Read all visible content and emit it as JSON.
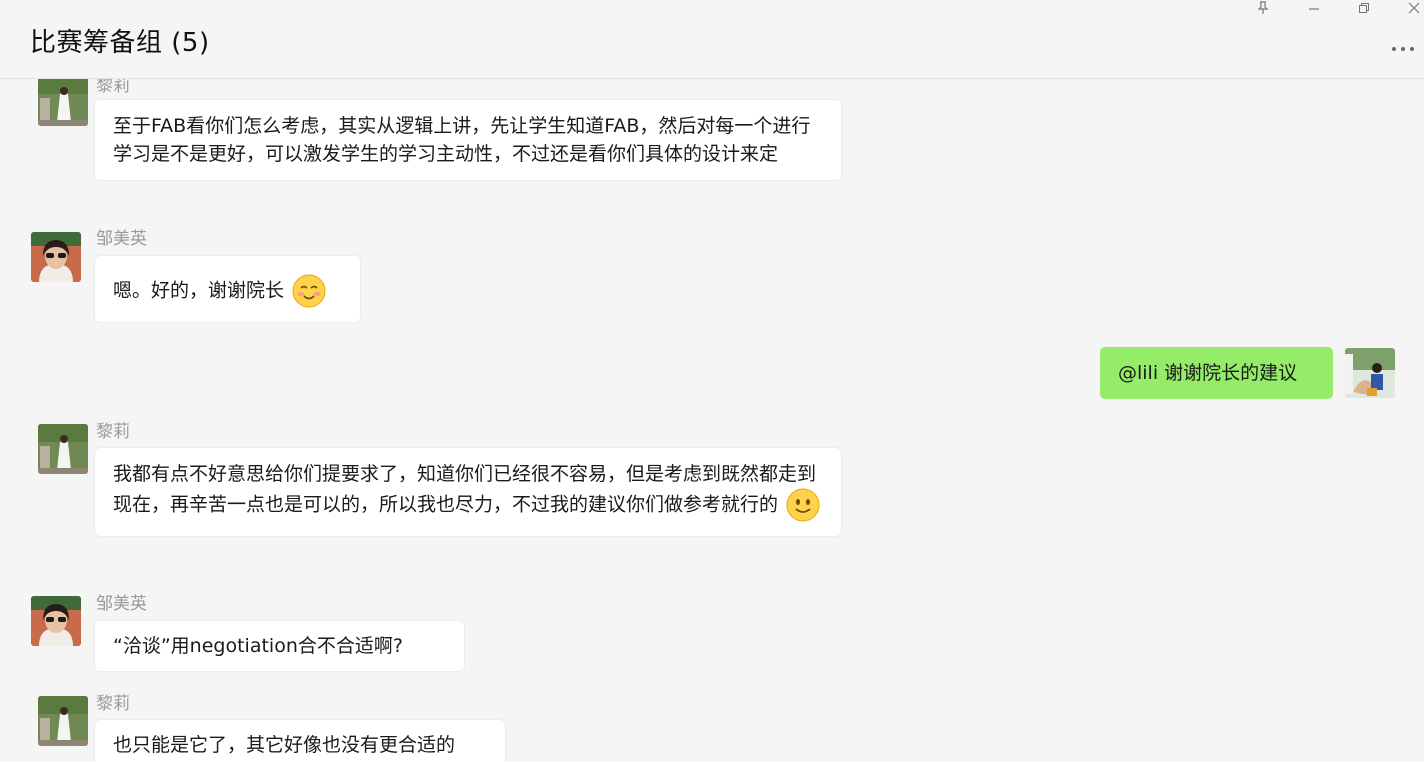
{
  "window": {
    "title": "比赛筹备组 (5)",
    "controls": [
      "pin-icon",
      "minimize-icon",
      "restore-icon",
      "close-icon"
    ],
    "more_icon": "more-dots-icon"
  },
  "colors": {
    "background": "#f5f5f5",
    "incoming_bubble": "#ffffff",
    "outgoing_bubble": "#95ec69",
    "sender_name": "#9a9a9a"
  },
  "messages": [
    {
      "sender": "黎莉",
      "direction": "in",
      "avatar": "avatar-lili",
      "text": "至于FAB看你们怎么考虑，其实从逻辑上讲，先让学生知道FAB，然后对每一个进行学习是不是更好，可以激发学生的学习主动性，不过还是看你们具体的设计来定"
    },
    {
      "sender": "邹美英",
      "direction": "in",
      "avatar": "avatar-zou",
      "text": "嗯。好的，谢谢院长",
      "emoji": "blush-emoji"
    },
    {
      "sender": "",
      "direction": "out",
      "avatar": "avatar-me",
      "text": "@lili 谢谢院长的建议"
    },
    {
      "sender": "黎莉",
      "direction": "in",
      "avatar": "avatar-lili",
      "text": "我都有点不好意思给你们提要求了，知道你们已经很不容易，但是考虑到既然都走到现在，再辛苦一点也是可以的，所以我也尽力，不过我的建议你们做参考就行的",
      "emoji": "smile-emoji"
    },
    {
      "sender": "邹美英",
      "direction": "in",
      "avatar": "avatar-zou",
      "text": "“洽谈”用negotiation合不合适啊?"
    },
    {
      "sender": "黎莉",
      "direction": "in",
      "avatar": "avatar-lili",
      "text": "也只能是它了，其它好像也没有更合适的"
    }
  ]
}
